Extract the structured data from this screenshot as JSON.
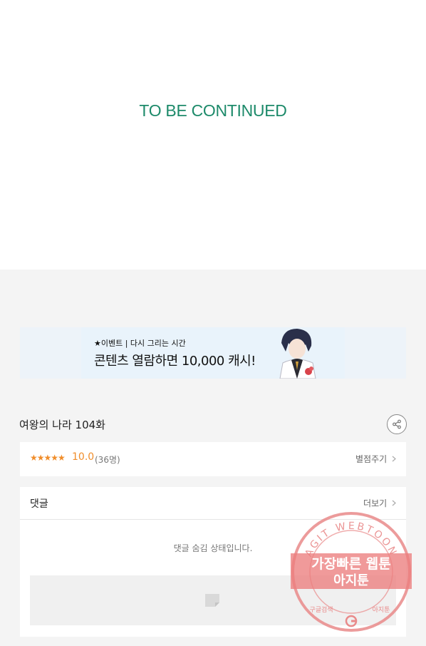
{
  "content": {
    "end_text": "TO BE CONTINUED"
  },
  "banner": {
    "event_line": "★이벤트 | 다시 그리는 시간",
    "headline": "콘텐츠 열람하면 10,000 캐시!"
  },
  "episode": {
    "title": "여왕의 나라 104화"
  },
  "rating": {
    "stars": "★★★★★",
    "score": "10.0",
    "count": "(36명)",
    "action_label": "별점주기"
  },
  "comments": {
    "title": "댓글",
    "more_label": "더보기",
    "hidden_message": "댓글 숨김 상태입니다."
  },
  "watermark": {
    "ring_text": "AGIT WEBTOON",
    "line1": "가장빠른 웹툰",
    "line2": "아지툰",
    "bottom_left": "구글검색",
    "bottom_right": "아지툰"
  },
  "colors": {
    "accent_green": "#1d8a6a",
    "rating_orange": "#f08d2a",
    "stamp_red": "#e86a6a"
  }
}
